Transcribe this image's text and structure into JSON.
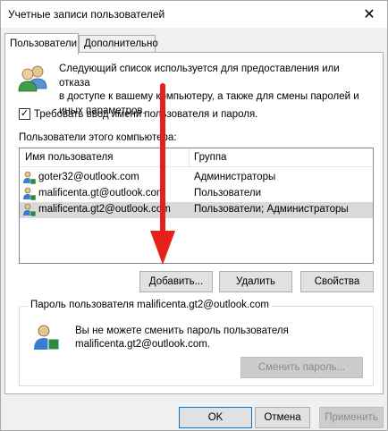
{
  "window": {
    "title": "Учетные записи пользователей",
    "close_glyph": "✕"
  },
  "tabs": [
    {
      "label": "Пользователи",
      "active": true
    },
    {
      "label": "Дополнительно",
      "active": false
    }
  ],
  "info": {
    "text_line1": "Следующий список используется для предоставления или отказа",
    "text_line2": "в доступе к вашему компьютеру, а также для смены паролей и",
    "text_line3": "иных параметров."
  },
  "require_login": {
    "checked": true,
    "check_glyph": "✓",
    "label": "Требовать ввод имени пользователя и пароля."
  },
  "users_section": {
    "label": "Пользователи этого компьютера:"
  },
  "users_table": {
    "columns": [
      "Имя пользователя",
      "Группа"
    ],
    "rows": [
      {
        "name": "goter32@outlook.com",
        "group": "Администраторы",
        "selected": false
      },
      {
        "name": "malificenta.gt@outlook.com",
        "group": "Пользователи",
        "selected": false
      },
      {
        "name": "malificenta.gt2@outlook.com",
        "group": "Пользователи; Администраторы",
        "selected": true
      }
    ]
  },
  "user_buttons": {
    "add": "Добавить...",
    "remove": "Удалить",
    "properties": "Свойства"
  },
  "password_group": {
    "title": "Пароль пользователя malificenta.gt2@outlook.com",
    "text_line1": "Вы не можете сменить пароль пользователя",
    "text_line2": "malificenta.gt2@outlook.com.",
    "change_button": "Сменить пароль..."
  },
  "dialog_buttons": {
    "ok": "OK",
    "cancel": "Отмена",
    "apply": "Применить"
  },
  "colors": {
    "arrow": "#e8201c",
    "focus_border": "#0078d7",
    "selected_row": "#d9d9d9"
  }
}
